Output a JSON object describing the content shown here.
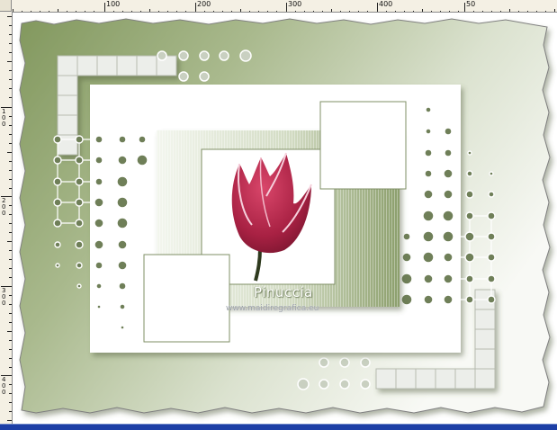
{
  "rulers": {
    "top_labels": [
      "100",
      "200",
      "300",
      "400",
      "50"
    ],
    "left_labels": [
      "1\n0\n0",
      "2\n0\n0",
      "3\n0\n0",
      "4\n0\n0"
    ]
  },
  "artwork": {
    "title": "Pinuccia",
    "url": "www.maidiregrafica.eu",
    "subject_icon": "tulip-flower-icon"
  },
  "colors": {
    "sage_green": "#8da06c",
    "frame_background": "#ffffff",
    "tulip_red": "#b0294a",
    "ruler_background": "#f4f0e4",
    "bottom_bar": "#1d3fa6"
  }
}
